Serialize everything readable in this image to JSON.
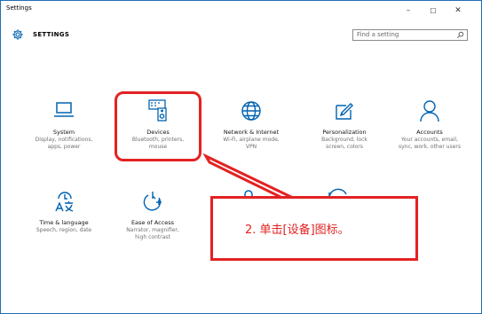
{
  "window": {
    "title": "Settings",
    "controls": {
      "minimize": "–",
      "maximize": "☐",
      "close": "✕"
    }
  },
  "header": {
    "label": "SETTINGS",
    "search_placeholder": "Find a setting"
  },
  "tiles": [
    {
      "title": "System",
      "subtitle_lines": [
        "Display, notifications,",
        "apps, power"
      ],
      "icon": "laptop-icon"
    },
    {
      "title": "Devices",
      "subtitle_lines": [
        "Bluetooth, printers,",
        "mouse"
      ],
      "icon": "devices-icon"
    },
    {
      "title": "Network & Internet",
      "subtitle_lines": [
        "Wi-Fi, airplane mode,",
        "VPN"
      ],
      "icon": "globe-icon"
    },
    {
      "title": "Personalization",
      "subtitle_lines": [
        "Background, lock",
        "screen, colors"
      ],
      "icon": "paint-icon"
    },
    {
      "title": "Accounts",
      "subtitle_lines": [
        "Your accounts, email,",
        "sync, work, other users"
      ],
      "icon": "person-icon"
    },
    {
      "title": "Time & language",
      "subtitle_lines": [
        "Speech, region, date"
      ],
      "icon": "language-icon"
    },
    {
      "title": "Ease of Access",
      "subtitle_lines": [
        "Narrator, magnifier,",
        "high contrast"
      ],
      "icon": "ease-of-access-icon"
    }
  ],
  "callout": {
    "text": "2. 单击[设备]图标。",
    "color": "#e32222"
  },
  "colors": {
    "accent": "#1f6fb5",
    "icon_blue": "#0063b1",
    "highlight_red": "#e32222"
  }
}
